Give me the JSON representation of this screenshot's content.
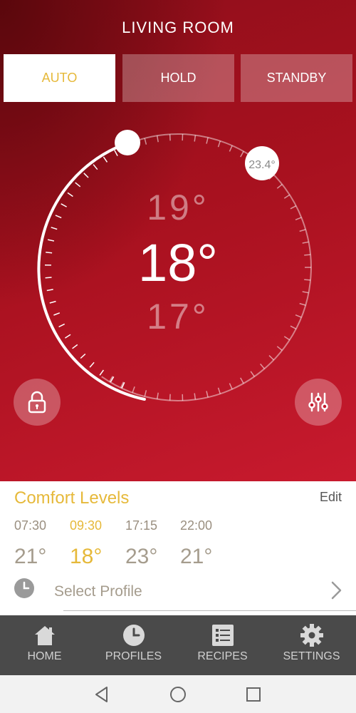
{
  "header": {
    "room": "LIVING ROOM"
  },
  "modes": [
    {
      "label": "AUTO",
      "active": true
    },
    {
      "label": "HOLD",
      "active": false
    },
    {
      "label": "STANDBY",
      "active": false
    }
  ],
  "dial": {
    "setpoint": "18°",
    "setpoint_up": "19°",
    "setpoint_down": "17°",
    "measured_temp": "23.4°"
  },
  "comfort": {
    "title": "Comfort Levels",
    "edit": "Edit",
    "levels": [
      {
        "time": "07:30",
        "temp": "21°"
      },
      {
        "time": "09:30",
        "temp": "18°"
      },
      {
        "time": "17:15",
        "temp": "23°"
      },
      {
        "time": "22:00",
        "temp": "21°"
      }
    ],
    "active_index": 1,
    "profile": "Select Profile"
  },
  "tabs": [
    {
      "label": "HOME",
      "icon": "home-icon"
    },
    {
      "label": "PROFILES",
      "icon": "clock-icon"
    },
    {
      "label": "RECIPES",
      "icon": "list-icon"
    },
    {
      "label": "SETTINGS",
      "icon": "gear-icon"
    }
  ],
  "colors": {
    "accent": "#e6b93a",
    "hero_dark": "#8e0e1a",
    "hero_light": "#c81a2e",
    "tabbar": "#4a4a4a"
  }
}
